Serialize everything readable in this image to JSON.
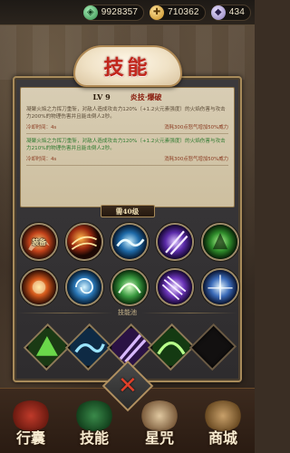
{
  "resources": [
    {
      "name": "jade",
      "value": "9928357"
    },
    {
      "name": "gold",
      "value": "710362"
    },
    {
      "name": "gem",
      "value": "434"
    }
  ],
  "title": "技能",
  "skill_detail": {
    "level": "LV 9",
    "name": "炎技·爆破",
    "current_desc": "凝聚火焰之力挥刀重斩，对敌人造成攻击力120%（+1.2火元素强度）的火焰伤害与攻击力200%的物理伤害并且能击倒人2秒。",
    "current_cd": "冷却时间：4s",
    "current_cost": "消耗300点怒气增加50%威力",
    "next_desc": "凝聚火焰之力挥刀重斩，对敌人造成攻击力120%（+1.2火元素强度）的火焰伤害与攻击力210%的物理伤害并且能击倒人2秒。",
    "next_cd": "冷却时间：4s",
    "next_cost": "消耗300点怒气增加50%威力"
  },
  "equip_title": "需40级",
  "equip_label": "装备",
  "pool_title": "技能池",
  "nav": [
    "行囊",
    "技能",
    "星咒",
    "商城"
  ],
  "close_label": "✕"
}
